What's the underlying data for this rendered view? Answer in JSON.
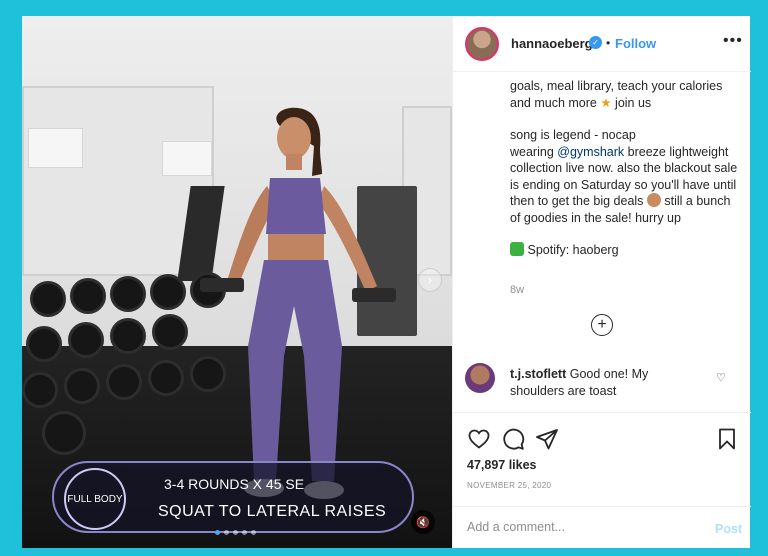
{
  "colors": {
    "background": "#1ec0da",
    "accent": "#3897f0",
    "text": "#262626",
    "muted": "#8e8e8e"
  },
  "media": {
    "overlay": {
      "badge": "FULL BODY",
      "line1": "3-4 ROUNDS X 45 SE",
      "line2": "SQUAT TO LATERAL RAISES"
    },
    "carousel_dots": 5,
    "active_dot": 0
  },
  "header": {
    "username": "hannaoeberg",
    "separator": "•",
    "follow_label": "Follow",
    "more_label": "•••"
  },
  "caption": {
    "p1_text": "goals, meal library, teach your calories and much more",
    "p1_end": "join us",
    "p2_a": "song is legend - nocap",
    "p2_b": "wearing",
    "p2_mention": "@gymshark",
    "p2_c": "breeze lightweight collection live now. also the blackout sale is ending on Saturday so you'll have until then to get the big deals",
    "p2_d": "still a bunch of goodies in the sale! hurry up",
    "p3": "Spotify: haoberg",
    "age": "8w"
  },
  "comment": {
    "user": "t.j.stoflett",
    "text": "Good one! My shoulders are toast"
  },
  "actions": {
    "likes": "47,897 likes",
    "date": "NOVEMBER 25, 2020",
    "add_comment_placeholder": "Add a comment...",
    "post_label": "Post"
  },
  "icons": [
    "heart-icon",
    "comment-icon",
    "share-icon",
    "bookmark-icon",
    "verified-icon",
    "plus-icon",
    "mute-icon",
    "next-icon"
  ]
}
